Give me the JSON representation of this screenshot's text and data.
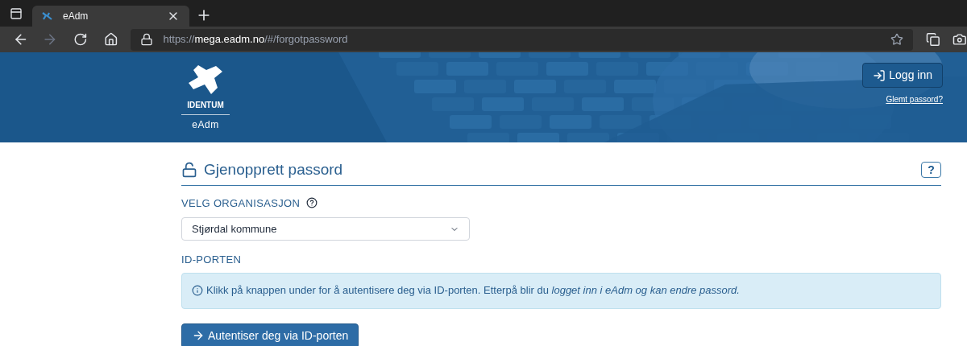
{
  "browser": {
    "tab": {
      "title": "eAdm",
      "selected": true
    },
    "url": "https://**mega.eadm.no**/#/forgotpassword"
  },
  "header": {
    "logo_brand": "IDENTUM",
    "logo_product": "eAdm",
    "login_button": "Logg inn",
    "forgot_link": "Glemt passord?"
  },
  "page": {
    "title": "Gjenopprett passord",
    "help_button": "?",
    "organization_label": "VELG ORGANISASJON",
    "organization_select": {
      "value": "Stjørdal kommune"
    },
    "id_porten_label": "ID-PORTEN",
    "info": "Klikk på knappen under for å autentisere deg via ID-porten. Etterpå blir du *logget inn i eAdm og kan endre passord.*",
    "authenticate_button": "Autentiser deg via ID-porten"
  }
}
